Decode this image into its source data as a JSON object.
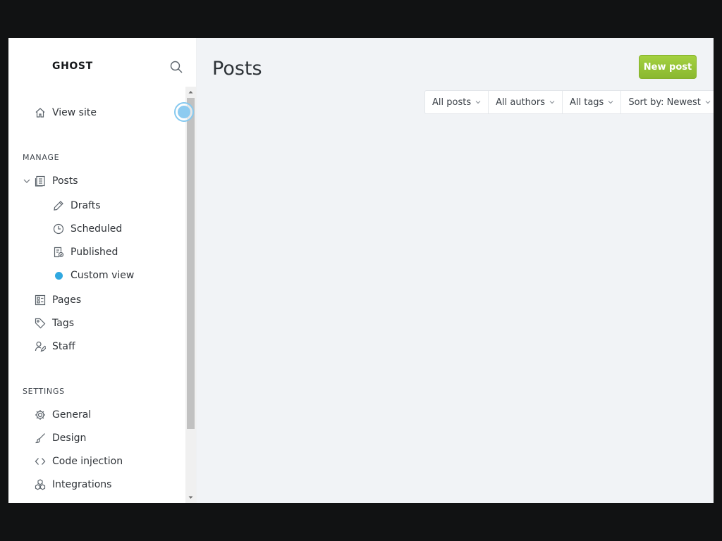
{
  "brand": "GHOST",
  "nav": {
    "view_site": "View site",
    "manage_heading": "MANAGE",
    "posts": "Posts",
    "drafts": "Drafts",
    "scheduled": "Scheduled",
    "published": "Published",
    "custom_view": "Custom view",
    "pages": "Pages",
    "tags": "Tags",
    "staff": "Staff",
    "settings_heading": "SETTINGS",
    "general": "General",
    "design": "Design",
    "code_injection": "Code injection",
    "integrations": "Integrations"
  },
  "main": {
    "title": "Posts",
    "new_post": "New post",
    "filters": {
      "type": "All posts",
      "authors": "All authors",
      "tags": "All tags",
      "sort": "Sort by: Newest"
    }
  },
  "colors": {
    "accent_green": "#9cca3b",
    "custom_view_dot": "#30a8e0",
    "page_background": "#f1f3f6"
  }
}
